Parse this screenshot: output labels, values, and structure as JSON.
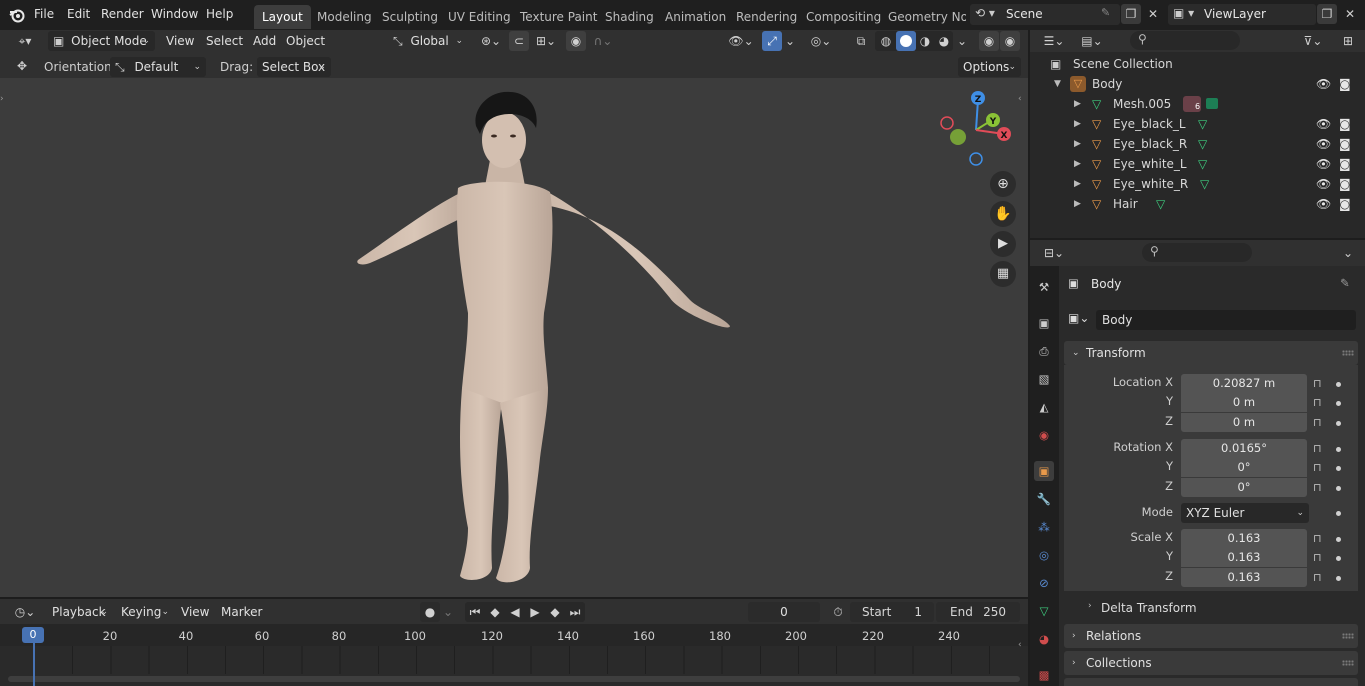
{
  "menus": {
    "file": "File",
    "edit": "Edit",
    "render": "Render",
    "window": "Window",
    "help": "Help"
  },
  "workspaces": [
    "Layout",
    "Modeling",
    "Sculpting",
    "UV Editing",
    "Texture Paint",
    "Shading",
    "Animation",
    "Rendering",
    "Compositing",
    "Geometry Noc"
  ],
  "scene": {
    "name": "Scene",
    "view_layer": "ViewLayer"
  },
  "viewport_header": {
    "mode": "Object Mode",
    "view": "View",
    "select": "Select",
    "add": "Add",
    "object": "Object",
    "transform_orientation": "Global"
  },
  "tool_header": {
    "orientation_label": "Orientation:",
    "orientation_value": "Default",
    "drag_label": "Drag:",
    "drag_value": "Select Box",
    "options": "Options"
  },
  "gizmo": {
    "z": "Z",
    "y": "Y",
    "x": "X"
  },
  "outliner": {
    "root": "Scene Collection",
    "items": [
      {
        "label": "Body",
        "level": 1,
        "type": "mesh"
      },
      {
        "label": "Mesh.005",
        "level": 2,
        "type": "meshdata",
        "badge": "6"
      },
      {
        "label": "Eye_black_L",
        "level": 2,
        "type": "mesh"
      },
      {
        "label": "Eye_black_R",
        "level": 2,
        "type": "mesh"
      },
      {
        "label": "Eye_white_L",
        "level": 2,
        "type": "mesh"
      },
      {
        "label": "Eye_white_R",
        "level": 2,
        "type": "mesh"
      },
      {
        "label": "Hair",
        "level": 2,
        "type": "mesh"
      }
    ]
  },
  "properties": {
    "object_name": "Body",
    "object_field": "Body",
    "transform_title": "Transform",
    "location_label": "Location X",
    "location": [
      "0.20827 m",
      "0 m",
      "0 m"
    ],
    "rotation_label": "Rotation X",
    "rotation": [
      "0.0165°",
      "0°",
      "0°"
    ],
    "mode_label": "Mode",
    "mode_value": "XYZ Euler",
    "scale_label": "Scale X",
    "scale": [
      "0.163",
      "0.163",
      "0.163"
    ],
    "y_label": "Y",
    "z_label": "Z",
    "delta_transform": "Delta Transform",
    "relations": "Relations",
    "collections": "Collections"
  },
  "timeline": {
    "playback": "Playback",
    "keying": "Keying",
    "view": "View",
    "marker": "Marker",
    "current_frame": "0",
    "start_label": "Start",
    "start_value": "1",
    "end_label": "End",
    "end_value": "250",
    "ruler": [
      "0",
      "20",
      "40",
      "60",
      "80",
      "100",
      "120",
      "140",
      "160",
      "180",
      "200",
      "220",
      "240"
    ]
  },
  "colors": {
    "accent_blue": "#4772b3",
    "object_orange": "#e8994a",
    "mesh_green": "#3ecb7e",
    "axis_x": "#e04c58",
    "axis_y": "#8ac236",
    "axis_z": "#3f8fe6"
  }
}
